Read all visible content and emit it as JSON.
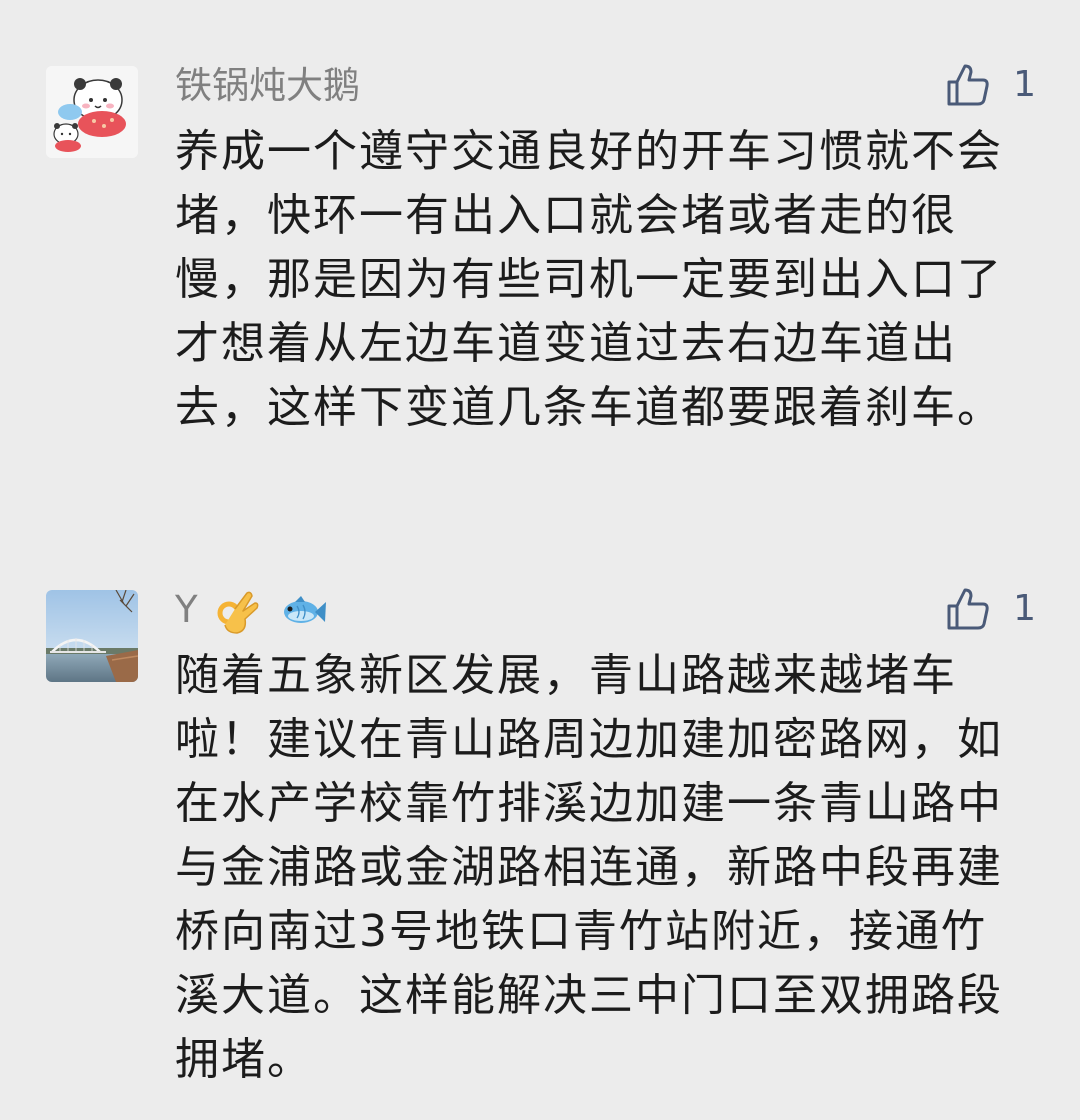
{
  "comments": [
    {
      "username": "铁锅炖大鹅",
      "like_count": "1",
      "avatar_icon": "cartoon-bear-avatar-icon",
      "content": "养成一个遵守交通良好的开车习惯就不会堵，快环一有出入口就会堵或者走的很慢，那是因为有些司机一定要到出入口了才想着从左边车道变道过去右边车道出去，这样下变道几条车道都要跟着刹车。"
    },
    {
      "username": "Y",
      "username_emojis": [
        "ok-hand-emoji",
        "fish-emoji"
      ],
      "like_count": "1",
      "avatar_icon": "bridge-photo-avatar-icon",
      "content": "随着五象新区发展，青山路越来越堵车啦！建议在青山路周边加建加密路网，如在水产学校靠竹排溪边加建一条青山路中与金浦路或金湖路相连通，新路中段再建桥向南过3号地铁口青竹站附近，接通竹溪大道。这样能解决三中门口至双拥路段拥堵。"
    }
  ],
  "colors": {
    "background": "#ececec",
    "username": "#808080",
    "content": "#1c1c1c",
    "like_icon": "#4a5a78"
  },
  "icons": {
    "like": "thumbs-up-icon"
  }
}
